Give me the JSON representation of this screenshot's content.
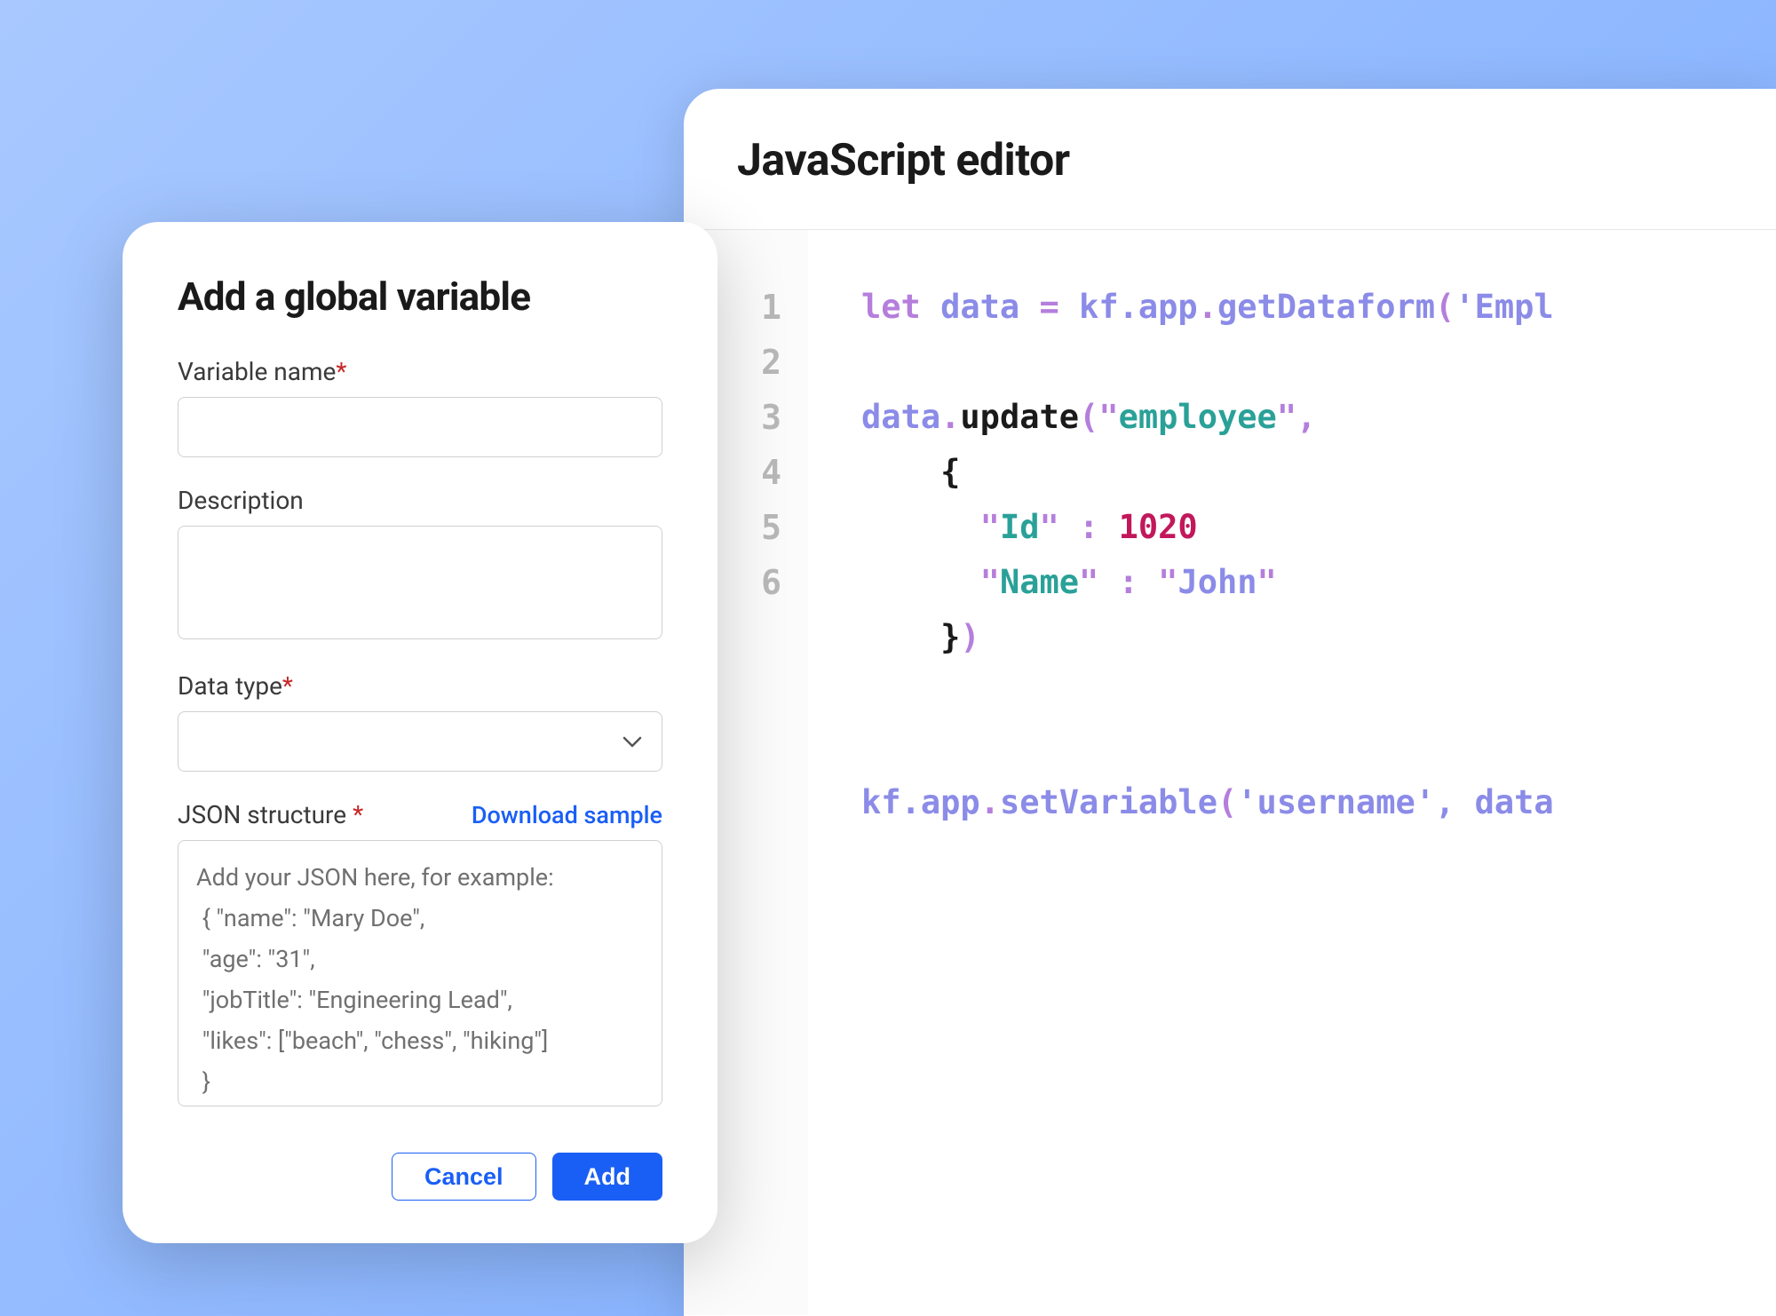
{
  "editor": {
    "title": "JavaScript editor",
    "line_numbers": [
      "1",
      "2",
      "3",
      "4",
      "5",
      "6"
    ],
    "code": {
      "line1_keyword": "let",
      "line1_ident": "data",
      "line1_eq": " = ",
      "line1_obj": "kf.app",
      "line1_dot": ".",
      "line1_method": "getDataform",
      "line1_paren_open": "(",
      "line1_arg": "'Empl",
      "line3_ident": "data",
      "line3_dot": ".",
      "line3_method": "update",
      "line3_paren_open": "(",
      "line3_q1": "\"",
      "line3_str": "employee",
      "line3_q2": "\"",
      "line3_comma": ",",
      "line4_brace": "{",
      "line5_q1": "\"",
      "line5_key": "Id",
      "line5_q2": "\"",
      "line5_colon": " : ",
      "line5_val": "1020",
      "line6_q1": "\"",
      "line6_key": "Name",
      "line6_q2": "\"",
      "line6_colon": " : ",
      "line6_q3": "\"",
      "line6_val": "John",
      "line6_q4": "\"",
      "line7_brace": "}",
      "line7_paren": ")",
      "line8_obj": "kf.app",
      "line8_dot": ".",
      "line8_method": "setVariable",
      "line8_paren_open": "(",
      "line8_q1": "'",
      "line8_arg1": "username",
      "line8_q2": "'",
      "line8_comma": ", ",
      "line8_arg2": "data"
    }
  },
  "modal": {
    "title": "Add a global variable",
    "variable_label": "Variable name",
    "variable_value": "",
    "description_label": "Description",
    "description_value": "",
    "datatype_label": "Data type",
    "datatype_value": "",
    "json_label": "JSON structure",
    "download_link": "Download sample",
    "json_placeholder": "Add your JSON here, for example:\n { \"name\": \"Mary Doe\",\n \"age\": \"31\",\n \"jobTitle\": \"Engineering Lead\",\n \"likes\": [\"beach\", \"chess\", \"hiking\"]\n }",
    "cancel_label": "Cancel",
    "add_label": "Add",
    "star": "*",
    "star_spaced": " *"
  }
}
